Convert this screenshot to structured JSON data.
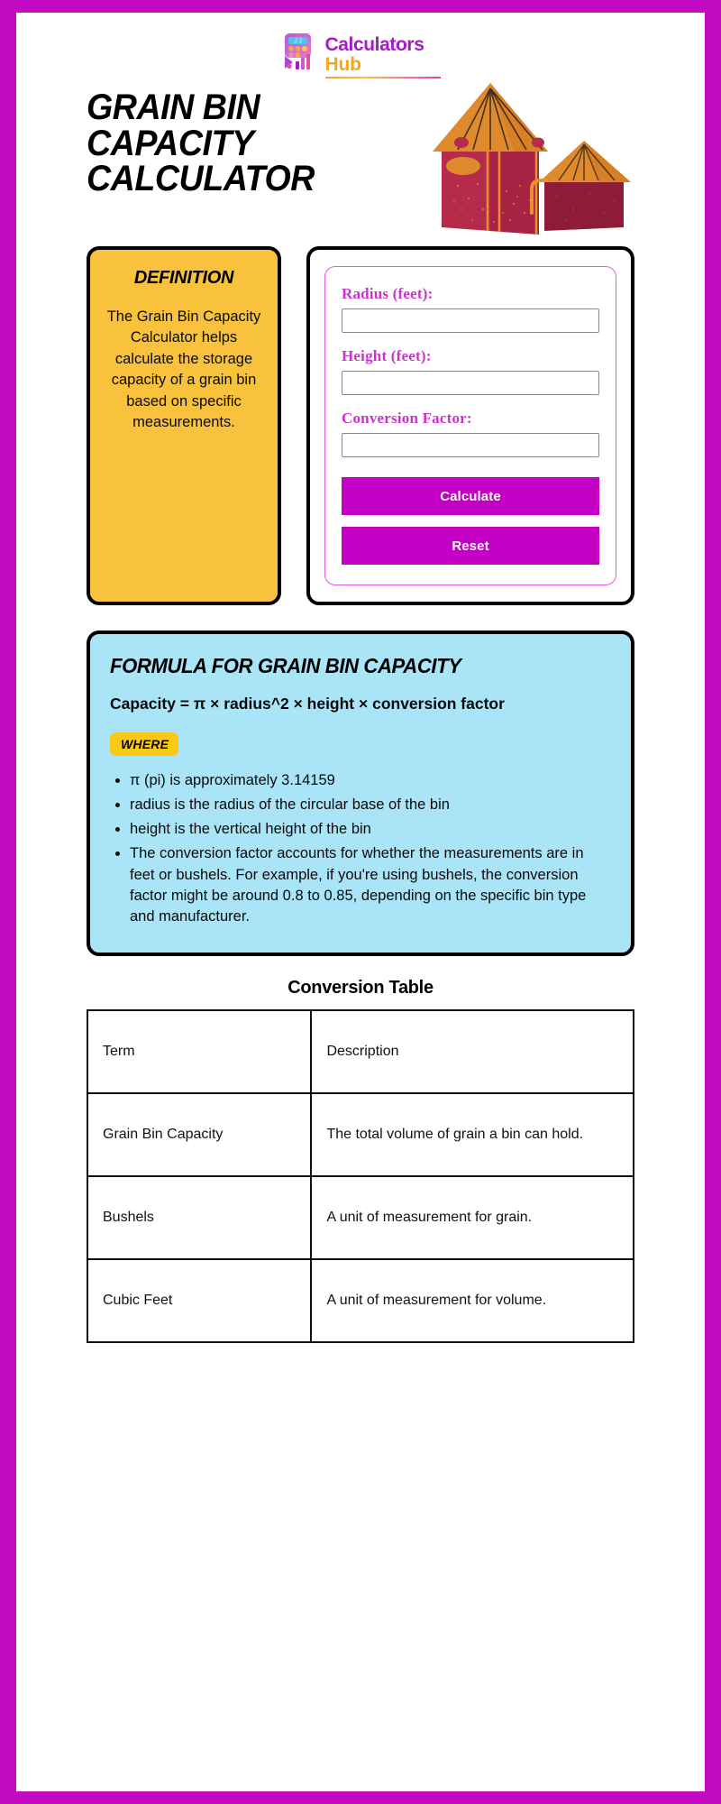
{
  "brand": {
    "name_line1": "Calculators",
    "name_line2": "Hub",
    "logo_icon": "calculator-chart-logo"
  },
  "hero": {
    "title_line1": "GRAIN BIN",
    "title_line2": "CAPACITY",
    "title_line3": "CALCULATOR",
    "illustration": "grain-bin-silos-illustration"
  },
  "definition": {
    "heading": "DEFINITION",
    "body": "The Grain Bin Capacity Calculator helps calculate the storage capacity of a grain bin based on specific measurements."
  },
  "form": {
    "fields": [
      {
        "label": "Radius (feet):",
        "value": "",
        "placeholder": ""
      },
      {
        "label": "Height (feet):",
        "value": "",
        "placeholder": ""
      },
      {
        "label": "Conversion Factor:",
        "value": "",
        "placeholder": ""
      }
    ],
    "calculate_label": "Calculate",
    "reset_label": "Reset",
    "accent_color": "#C300C3",
    "label_color": "#CC33CC"
  },
  "formula": {
    "heading": "FORMULA FOR GRAIN BIN CAPACITY",
    "expression": "Capacity = π × radius^2 × height × conversion factor",
    "where_badge": "WHERE",
    "bullets": [
      "π (pi) is approximately 3.14159",
      "radius is the radius of the circular base of the bin",
      "height is the vertical height of the bin",
      "The conversion factor accounts for whether the measurements are in feet or bushels. For example, if you're using bushels, the conversion factor might be around 0.8 to 0.85, depending on the specific bin type and manufacturer."
    ],
    "background_color": "#A9E4F7"
  },
  "conversion_table": {
    "heading": "Conversion Table",
    "columns": [
      "Term",
      "Description"
    ],
    "rows": [
      [
        "Grain Bin Capacity",
        "The total volume of grain a bin can hold."
      ],
      [
        "Bushels",
        "A unit of measurement for grain."
      ],
      [
        "Cubic Feet",
        "A unit of measurement for volume."
      ]
    ]
  },
  "theme": {
    "frame_color": "#C209C2",
    "definition_bg": "#F9C23C",
    "badge_bg": "#FBC914"
  }
}
